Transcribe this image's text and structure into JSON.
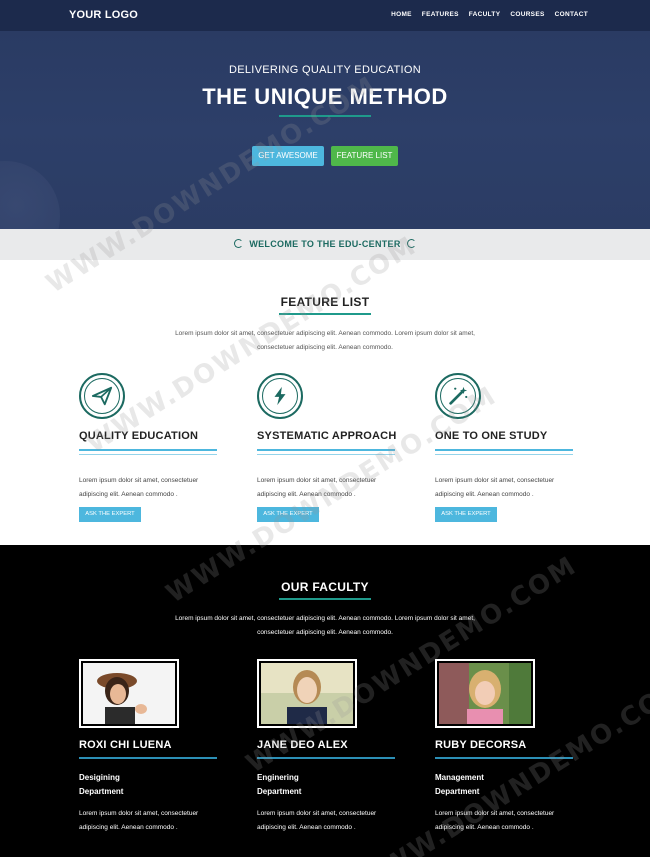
{
  "nav": {
    "logo": "YOUR LOGO",
    "items": [
      "HOME",
      "FEATURES",
      "FACULTY",
      "COURSES",
      "CONTACT"
    ]
  },
  "hero": {
    "subtitle": "DELIVERING QUALITY EDUCATION",
    "title": "THE UNIQUE METHOD",
    "btn_primary": "GET AWESOME",
    "btn_secondary": "FEATURE LIST"
  },
  "welcome": {
    "text": "WELCOME TO THE EDU-CENTER"
  },
  "features": {
    "title": "FEATURE LIST",
    "intro_line1": "Lorem ipsum dolor sit amet, consectetuer adipiscing elit. Aenean commodo. Lorem ipsum dolor sit amet,",
    "intro_line2": "consectetuer adipiscing elit. Aenean commodo.",
    "items": [
      {
        "icon": "paper-plane-icon",
        "title": "QUALITY EDUCATION",
        "text1": "Lorem ipsum dolor sit amet, consectetuer",
        "text2": "adipiscing elit. Aenean commodo .",
        "button": "ASK THE EXPERT"
      },
      {
        "icon": "lightning-icon",
        "title": "SYSTEMATIC APPROACH",
        "text1": "Lorem ipsum dolor sit amet, consectetuer",
        "text2": "adipiscing elit. Aenean commodo .",
        "button": "ASK THE EXPERT"
      },
      {
        "icon": "magic-wand-icon",
        "title": "ONE TO ONE STUDY",
        "text1": "Lorem ipsum dolor sit amet, consectetuer",
        "text2": "adipiscing elit. Aenean commodo .",
        "button": "ASK THE EXPERT"
      }
    ]
  },
  "faculty": {
    "title": "OUR FACULTY",
    "intro_line1": "Lorem ipsum dolor sit amet, consectetuer adipiscing elit. Aenean commodo. Lorem ipsum dolor sit amet,",
    "intro_line2": "consectetuer adipiscing elit. Aenean commodo.",
    "members": [
      {
        "name": "ROXI CHI LUENA",
        "dept1": "Desigining",
        "dept2": "Department",
        "text1": "Lorem ipsum dolor sit amet, consectetuer",
        "text2": "adipiscing elit. Aenean commodo ."
      },
      {
        "name": "JANE DEO ALEX",
        "dept1": "Enginering",
        "dept2": "Department",
        "text1": "Lorem ipsum dolor sit amet, consectetuer",
        "text2": "adipiscing elit. Aenean commodo ."
      },
      {
        "name": "RUBY DECORSA",
        "dept1": "Management",
        "dept2": "Department",
        "text1": "Lorem ipsum dolor sit amet, consectetuer",
        "text2": "adipiscing elit. Aenean commodo ."
      }
    ]
  },
  "watermark": "WWW.DOWNDEMO.COM",
  "colors": {
    "nav": "#1c2a4c",
    "hero": "#2d3f69",
    "accent_teal": "#1f9a8b",
    "accent_blue": "#4db7de",
    "accent_green": "#4fb84a",
    "dark_teal": "#1c6a61"
  }
}
